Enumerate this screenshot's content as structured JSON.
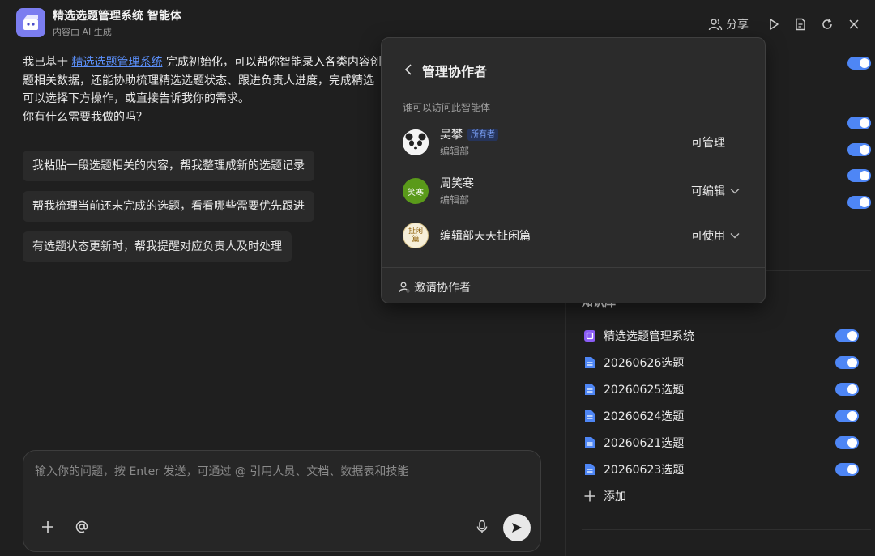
{
  "app": {
    "title": "精选选题管理系统 智能体",
    "subtitle": "内容由 AI 生成"
  },
  "header": {
    "share_label": "分享",
    "icons": [
      "people-icon",
      "play-icon",
      "document-icon",
      "refresh-icon",
      "close-icon"
    ]
  },
  "chat": {
    "intro_prefix": "我已基于 ",
    "intro_link": "精选选题管理系统",
    "intro_line1_suffix": " 完成初始化，可以帮你智能录入各类内容创",
    "intro_line2": "题相关数据，还能协助梳理精选选题状态、跟进负责人进度，完成精选",
    "intro_line3": "可以选择下方操作，或直接告诉我你的需求。",
    "intro_line4": "你有什么需要我做的吗？",
    "suggestions": [
      "我粘贴一段选题相关的内容，帮我整理成新的选题记录",
      "帮我梳理当前还未完成的选题，看看哪些需要优先跟进",
      "有选题状态更新时，帮我提醒对应负责人及时处理"
    ]
  },
  "composer": {
    "placeholder": "输入你的问题，按 Enter 发送，可通过 @ 引用人员、文档、数据表和技能",
    "value": ""
  },
  "popover": {
    "title": "管理协作者",
    "caption": "谁可以访问此智能体",
    "collaborators": [
      {
        "name": "吴攀",
        "badge": "所有者",
        "dept": "编辑部",
        "permission": "可管理",
        "has_dropdown": false
      },
      {
        "name": "周笑寒",
        "avatar_text": "笑寒",
        "dept": "编辑部",
        "permission": "可编辑",
        "has_dropdown": true
      },
      {
        "name": "编辑部天天扯闲篇",
        "avatar_text": "扯闲篇",
        "dept": "",
        "permission": "可使用",
        "has_dropdown": true
      }
    ],
    "invite_label": "邀请协作者"
  },
  "right_panel": {
    "kb_title": "知识库",
    "items": [
      {
        "label": "精选选题管理系统",
        "icon": "base-icon",
        "enabled": true
      },
      {
        "label": "20260626选题",
        "icon": "doc-icon",
        "enabled": true
      },
      {
        "label": "20260625选题",
        "icon": "doc-icon",
        "enabled": true
      },
      {
        "label": "20260624选题",
        "icon": "doc-icon",
        "enabled": true
      },
      {
        "label": "20260621选题",
        "icon": "doc-icon",
        "enabled": true
      },
      {
        "label": "20260623选题",
        "icon": "doc-icon",
        "enabled": true
      }
    ],
    "add_label": "添加"
  },
  "colors": {
    "accent": "#4e86f5",
    "link": "#5b8ff9",
    "background": "#1f1f1f",
    "popover": "#2b2b2b"
  }
}
